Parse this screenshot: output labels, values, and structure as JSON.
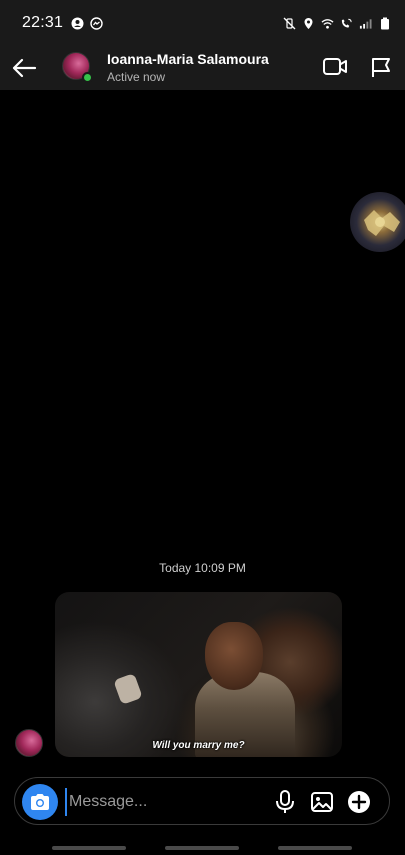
{
  "status_bar": {
    "time": "22:31",
    "left_icons": [
      "account-circle-icon",
      "messenger-icon"
    ],
    "right_icons": [
      "vibrate-mute-icon",
      "location-icon",
      "wifi-icon",
      "wifi-call-icon",
      "signal-icon",
      "battery-icon"
    ]
  },
  "header": {
    "contact_name": "Ioanna-Maria Salamoura",
    "status": "Active now"
  },
  "conversation": {
    "timestamp": "Today 10:09 PM",
    "gif_caption": "Will you marry me?"
  },
  "composer": {
    "placeholder": "Message..."
  },
  "colors": {
    "accent": "#2f86f0",
    "online": "#36c24a",
    "bar_bg": "#1a1a1a"
  }
}
